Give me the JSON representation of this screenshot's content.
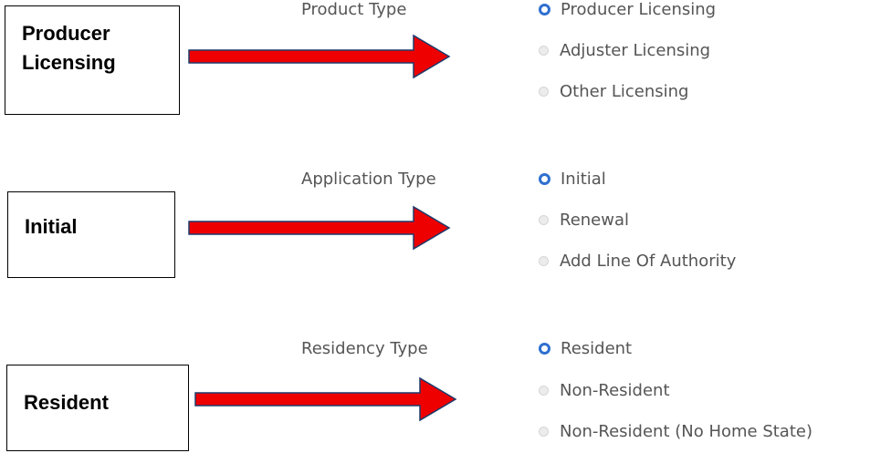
{
  "sections": [
    {
      "callout": [
        "Producer",
        "Licensing"
      ],
      "label": "Product Type",
      "options": [
        {
          "label": "Producer Licensing",
          "checked": true
        },
        {
          "label": "Adjuster Licensing",
          "checked": false
        },
        {
          "label": "Other Licensing",
          "checked": false
        }
      ]
    },
    {
      "callout": [
        "Initial"
      ],
      "label": "Application Type",
      "options": [
        {
          "label": "Initial",
          "checked": true
        },
        {
          "label": "Renewal",
          "checked": false
        },
        {
          "label": "Add Line Of Authority",
          "checked": false
        }
      ]
    },
    {
      "callout": [
        "Resident"
      ],
      "label": "Residency Type",
      "options": [
        {
          "label": "Resident",
          "checked": true
        },
        {
          "label": "Non-Resident",
          "checked": false
        },
        {
          "label": "Non-Resident (No Home State)",
          "checked": false
        }
      ]
    }
  ],
  "colors": {
    "arrow_fill": "#ee0000",
    "arrow_outline": "#1f3a6b",
    "radio_checked": "#2f6fd0",
    "label_text": "#555555"
  }
}
